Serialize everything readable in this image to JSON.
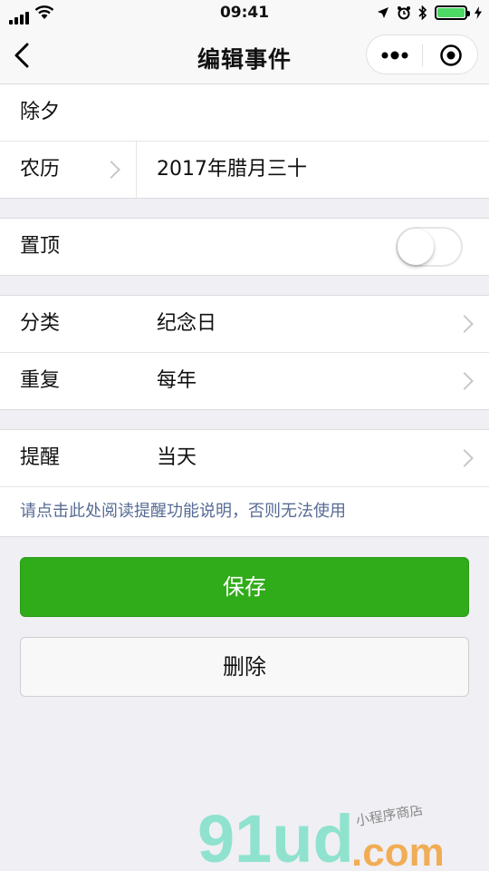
{
  "status": {
    "time": "09:41"
  },
  "nav": {
    "title": "编辑事件"
  },
  "event": {
    "name": "除夕",
    "calendar_label": "农历",
    "date": "2017年腊月三十"
  },
  "pin": {
    "label": "置顶",
    "on": false
  },
  "category": {
    "label": "分类",
    "value": "纪念日"
  },
  "repeat": {
    "label": "重复",
    "value": "每年"
  },
  "reminder": {
    "label": "提醒",
    "value": "当天",
    "help_link": "请点击此处阅读提醒功能说明，否则无法使用"
  },
  "buttons": {
    "save": "保存",
    "delete": "删除"
  },
  "watermark": {
    "brand": "91ud",
    "domain": ".com",
    "tagline": "小程序商店"
  },
  "colors": {
    "primary": "#30ab19",
    "link": "#576b95",
    "battery": "#4cd964"
  }
}
